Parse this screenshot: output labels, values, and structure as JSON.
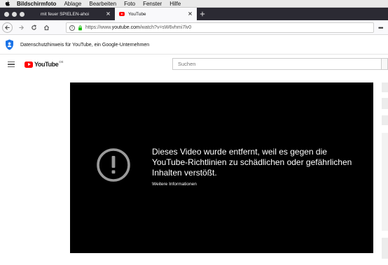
{
  "menubar": {
    "app": "Bildschirmfoto",
    "items": [
      "Ablage",
      "Bearbeiten",
      "Foto",
      "Fenster",
      "Hilfe"
    ]
  },
  "tabs": [
    {
      "label": "mit feuer SPIELEN-ahoi",
      "active": false
    },
    {
      "label": "YouTube",
      "active": true
    }
  ],
  "toolbar": {
    "url_prefix": "https://www.",
    "url_host": "youtube.com",
    "url_path": "/watch?v=sW6vhmi7lv0"
  },
  "privacy_banner": {
    "text": "Datenschutzhinweis für YouTube, ein Google-Unternehmen"
  },
  "header": {
    "logo_text": "YouTube",
    "country_code": "DE",
    "search_placeholder": "Suchen"
  },
  "player": {
    "message": "Dieses Video wurde entfernt, weil es gegen die YouTube-Richtlinien zu schädlichen oder gefährlichen Inhalten verstößt.",
    "more_info": "Weitere Informationen"
  },
  "colors": {
    "yt_red": "#ff0000",
    "tabstrip": "#2b2a33",
    "player_bg": "#000000",
    "shield_blue": "#1a73e8"
  },
  "icons": [
    "apple-icon",
    "close-icon",
    "back-icon",
    "forward-icon",
    "reload-icon",
    "home-icon",
    "info-icon",
    "lock-icon",
    "shield-icon",
    "hamburger-icon",
    "alert-icon"
  ]
}
